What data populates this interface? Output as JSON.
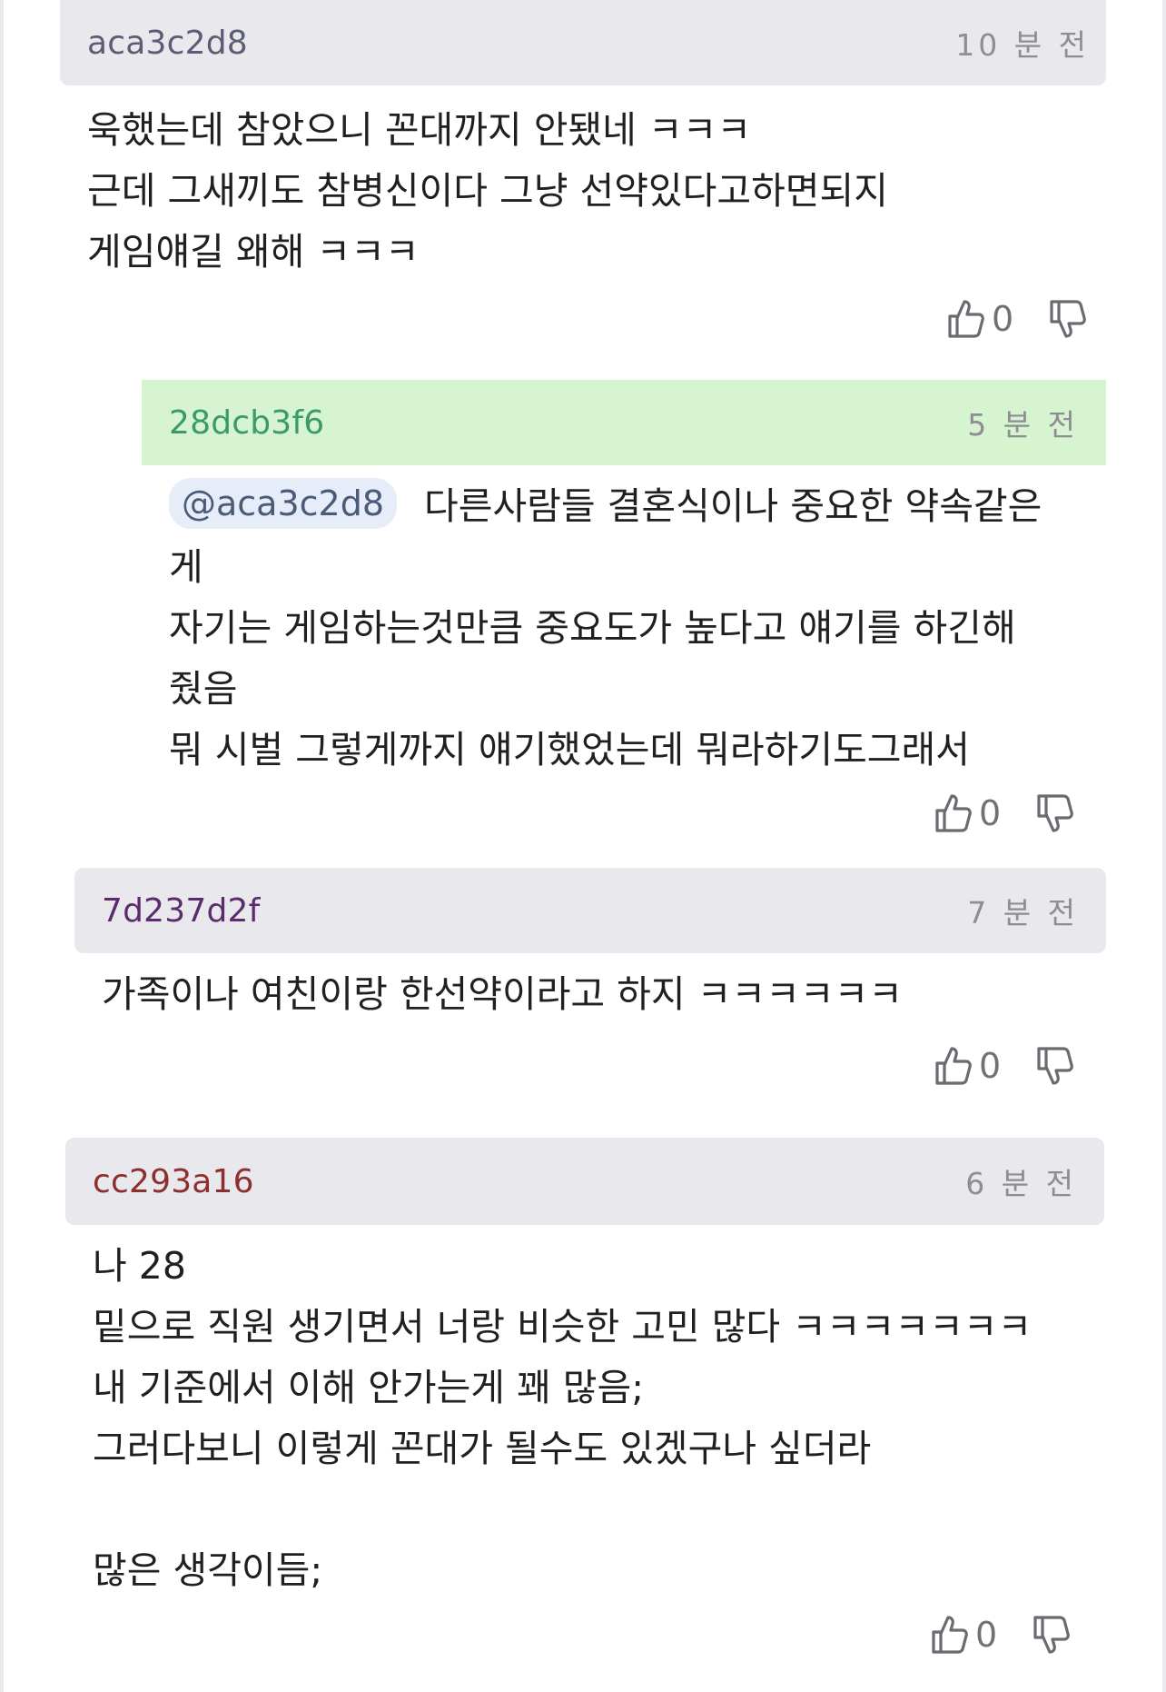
{
  "comments": [
    {
      "author": "aca3c2d8",
      "time": "10 분 전",
      "author_color": "#5c5c75",
      "lines": [
        "욱했는데 참았으니 꼰대까지 안됐네 ㅋㅋㅋ",
        "근데 그새끼도 참병신이다 그냥 선약있다고하면되지",
        "게임얘길 왜해 ㅋㅋㅋ"
      ],
      "likes": "0"
    },
    {
      "author": "28dcb3f6",
      "time": "5 분 전",
      "author_color": "#3b9a6c",
      "mention": "@aca3c2d8",
      "lines": [
        "다른사람들 결혼식이나 중요한 약속같은",
        "게",
        "자기는 게임하는것만큼 중요도가 높다고 얘기를 하긴해",
        "줬음",
        "뭐 시벌 그렇게까지 얘기했었는데 뭐라하기도그래서"
      ],
      "likes": "0"
    },
    {
      "author": "7d237d2f",
      "time": "7 분 전",
      "author_color": "#5a2c6e",
      "lines": [
        "가족이나 여친이랑 한선약이라고 하지 ㅋㅋㅋㅋㅋㅋ"
      ],
      "likes": "0"
    },
    {
      "author": "cc293a16",
      "time": "6 분 전",
      "author_color": "#8e2f2f",
      "lines": [
        "나 28",
        "밑으로 직원 생기면서 너랑 비슷한 고민 많다 ㅋㅋㅋㅋㅋㅋㅋ",
        "내 기준에서 이해 안가는게 꽤 많음;",
        "그러다보니 이렇게 꼰대가 될수도 있겠구나 싶더라",
        "",
        "많은 생각이듬;"
      ],
      "likes": "0"
    }
  ],
  "icons": {
    "like": "thumbs-up-icon",
    "dislike": "thumbs-down-icon"
  }
}
